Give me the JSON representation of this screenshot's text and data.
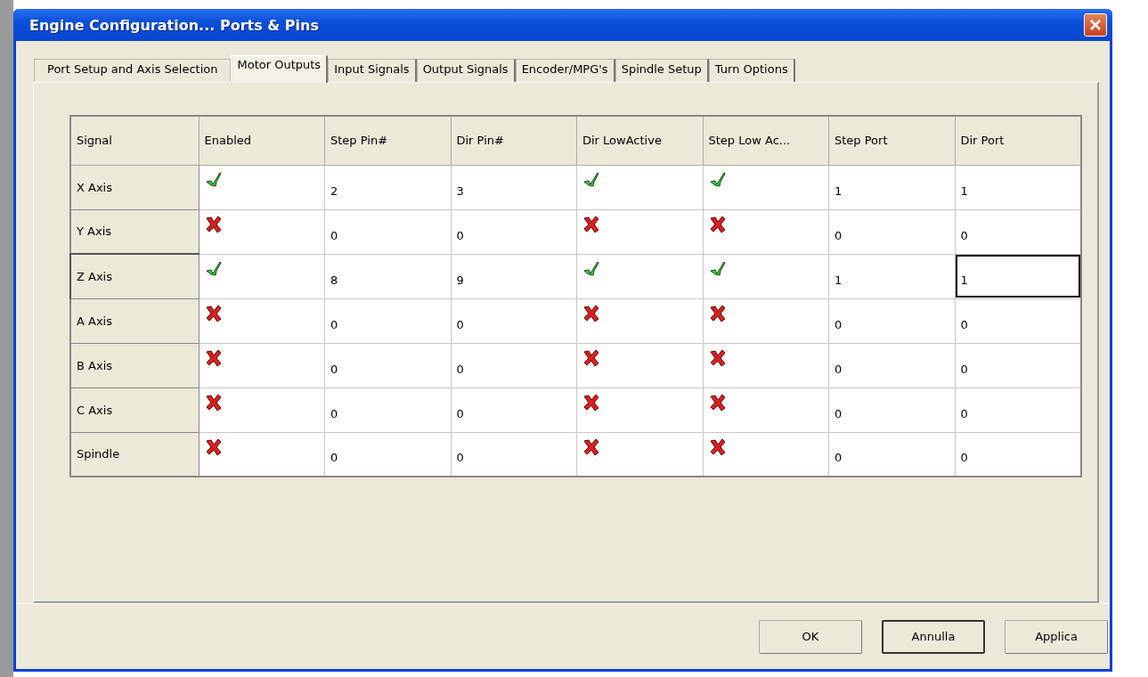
{
  "window": {
    "title": "Engine Configuration... Ports & Pins"
  },
  "tabs": [
    {
      "label": "Port Setup and Axis Selection",
      "selected": false
    },
    {
      "label": "Motor Outputs",
      "selected": true
    },
    {
      "label": "Input Signals",
      "selected": false
    },
    {
      "label": "Output Signals",
      "selected": false
    },
    {
      "label": "Encoder/MPG's",
      "selected": false
    },
    {
      "label": "Spindle Setup",
      "selected": false
    },
    {
      "label": "Turn Options",
      "selected": false
    }
  ],
  "table": {
    "columns": [
      {
        "label": "Signal",
        "kind": "header"
      },
      {
        "label": "Enabled",
        "kind": "flag"
      },
      {
        "label": "Step Pin#",
        "kind": "text"
      },
      {
        "label": "Dir Pin#",
        "kind": "text"
      },
      {
        "label": "Dir LowActive",
        "kind": "flag"
      },
      {
        "label": "Step Low Ac...",
        "kind": "flag"
      },
      {
        "label": "Step Port",
        "kind": "text"
      },
      {
        "label": "Dir Port",
        "kind": "text"
      }
    ],
    "rows": [
      {
        "selected": false,
        "cells": [
          "X Axis",
          true,
          "2",
          "3",
          true,
          true,
          "1",
          "1"
        ]
      },
      {
        "selected": false,
        "cells": [
          "Y Axis",
          false,
          "0",
          "0",
          false,
          false,
          "0",
          "0"
        ]
      },
      {
        "selected": true,
        "cells": [
          "Z Axis",
          true,
          "8",
          "9",
          true,
          true,
          "1",
          "1"
        ]
      },
      {
        "selected": false,
        "cells": [
          "A Axis",
          false,
          "0",
          "0",
          false,
          false,
          "0",
          "0"
        ]
      },
      {
        "selected": false,
        "cells": [
          "B Axis",
          false,
          "0",
          "0",
          false,
          false,
          "0",
          "0"
        ]
      },
      {
        "selected": false,
        "cells": [
          "C Axis",
          false,
          "0",
          "0",
          false,
          false,
          "0",
          "0"
        ]
      },
      {
        "selected": false,
        "cells": [
          "Spindle",
          false,
          "0",
          "0",
          false,
          false,
          "0",
          "0"
        ]
      }
    ]
  },
  "buttons": [
    {
      "label": "OK",
      "default": false
    },
    {
      "label": "Annulla",
      "default": true
    },
    {
      "label": "Applica",
      "default": false
    }
  ]
}
